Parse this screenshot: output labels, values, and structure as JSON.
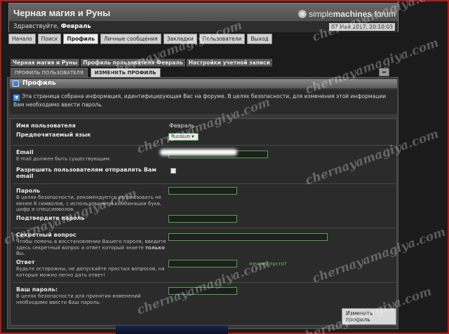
{
  "header": {
    "site_title": "Черная магия и Руны",
    "logo_part1": "simple",
    "logo_part2": "machines",
    "logo_part3": " forum",
    "greeting_prefix": "Здравствуйте, ",
    "greeting_user": "Февраль",
    "datetime": "07 Май 2017, 20:10:03"
  },
  "nav": [
    "Начало",
    "Поиск",
    "Профиль",
    "Личные сообщения",
    "Закладки",
    "Пользователи",
    "Выход"
  ],
  "nav_active": 2,
  "breadcrumb": [
    "Черная магия и Руны",
    "Профиль пользователя Февраль",
    "Настройки учетной записи"
  ],
  "profile_tabs": [
    "ПРОФИЛЬ ПОЛЬЗОВАТЕЛЯ",
    "ИЗМЕНИТЬ ПРОФИЛЬ"
  ],
  "profile_tab_active": 1,
  "section": {
    "title": "Профиль",
    "description": "Эта страница собрана информация, идентифицирующая Вас на форуме. В целях безопасности, для изменения этой информации Вам необходимо ввести пароль."
  },
  "form": {
    "username_label": "Имя пользователя",
    "username_value": "Февраль",
    "language_label": "Предпочитаемый язык",
    "language_value": "Russian",
    "email_label": "Email",
    "email_hint": "E-mail должен быть существующим.",
    "allow_email_label": "Разрешить пользователям отправлять Вам email",
    "password_label": "Пароль",
    "password_hint": "В целях безопасности, рекомендуется использовать не менее 6 символов, с использованием комбинации букв, цифр и спецсимволов.",
    "confirm_label": "Подтвердите пароль",
    "secret_q_label": "Секретный вопрос",
    "secret_q_hint_1": "Чтобы помочь в восстановлении Вашего пароля, введите здесь секретный вопрос и ответ который знаете ",
    "secret_q_hint_bold": "только",
    "secret_q_hint_2": " Вы.",
    "answer_label": "Ответ",
    "answer_hint": "Будьте осторожны, не допускайте простых вопросов, на которые можно легко дать ответ!",
    "why_empty_link": "почему пусто?",
    "your_password_label": "Ваш пароль:",
    "your_password_hint": "В целях безопасности для принятия изменений необходимо ввести Ваш пароль.",
    "submit_label": "Изменить профиль"
  },
  "watermark": "chernayamagiya.com",
  "colors": {
    "frame": "#b11a1a",
    "input_border": "#4aa64a",
    "info_icon": "#3d8ee8"
  }
}
